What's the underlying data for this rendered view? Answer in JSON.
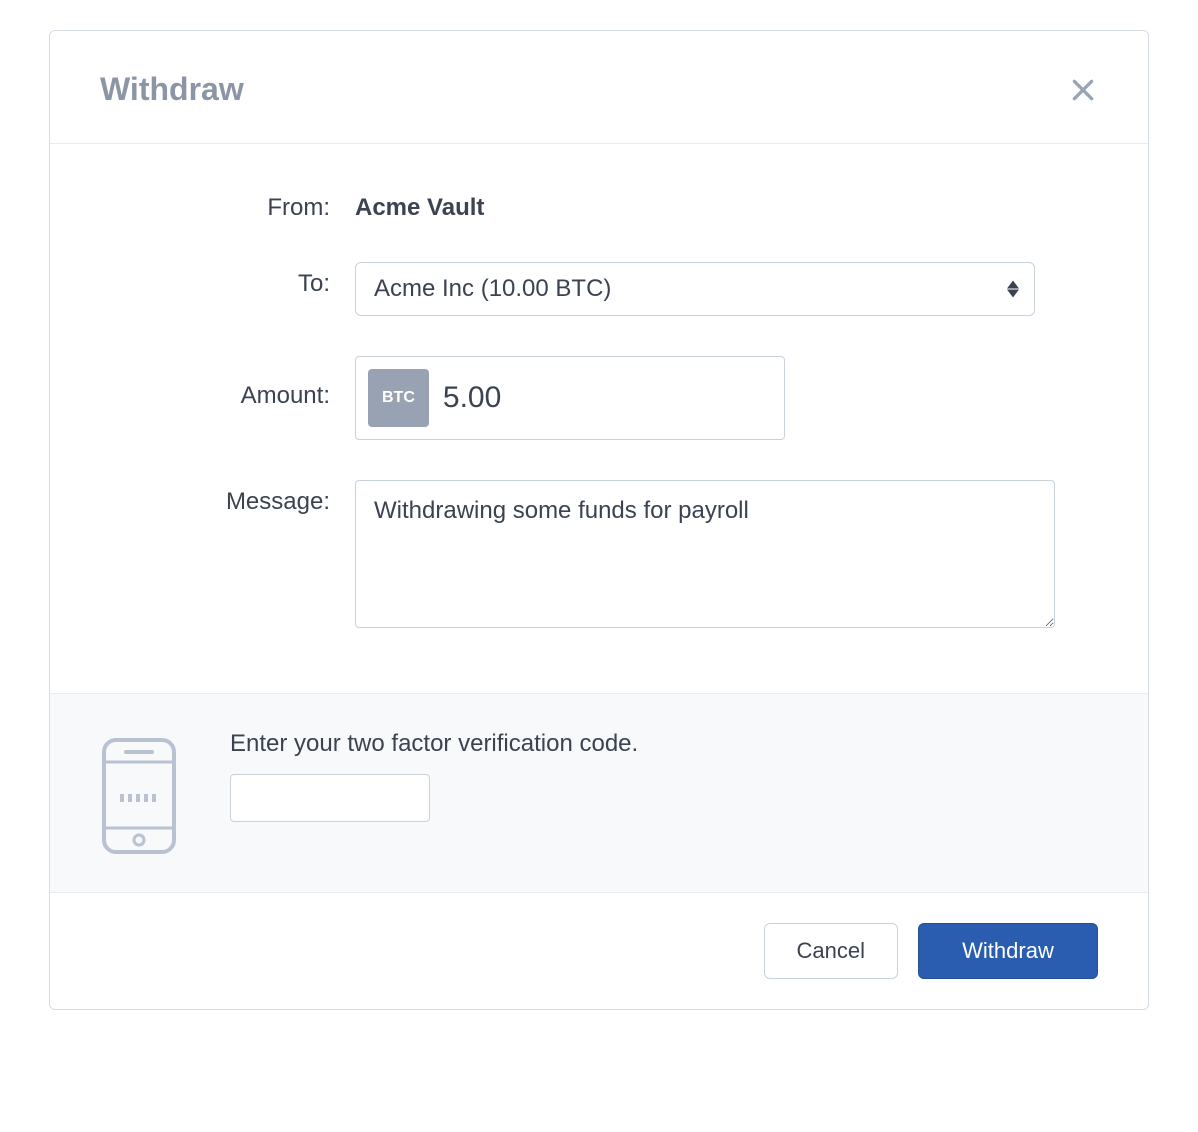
{
  "modal": {
    "title": "Withdraw"
  },
  "labels": {
    "from": "From:",
    "to": "To:",
    "amount": "Amount:",
    "message": "Message:"
  },
  "form": {
    "from_value": "Acme Vault",
    "to_selected": "Acme Inc (10.00 BTC)",
    "currency_badge": "BTC",
    "amount_value": "5.00",
    "message_value": "Withdrawing some funds for payroll"
  },
  "twofa": {
    "label": "Enter your two factor verification code.",
    "value": ""
  },
  "footer": {
    "cancel_label": "Cancel",
    "submit_label": "Withdraw"
  }
}
